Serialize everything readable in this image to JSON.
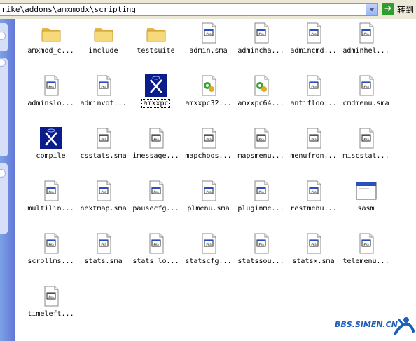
{
  "address": {
    "path": "rike\\addons\\amxmodx\\scripting",
    "go_label": "转到"
  },
  "colors": {
    "sidebar": "#6b8de0",
    "selection": "#316ac5",
    "folder": "#f3d36b"
  },
  "files": [
    {
      "name": "amxmod_c...",
      "icon": "folder-icon"
    },
    {
      "name": "include",
      "icon": "folder-icon"
    },
    {
      "name": "testsuite",
      "icon": "folder-icon"
    },
    {
      "name": "admin.sma",
      "icon": "sma-file-icon"
    },
    {
      "name": "adminchа...",
      "icon": "sma-file-icon"
    },
    {
      "name": "admincmd...",
      "icon": "sma-file-icon"
    },
    {
      "name": "adminhel...",
      "icon": "sma-file-icon"
    },
    {
      "name": "adminslo...",
      "icon": "sma-file-icon"
    },
    {
      "name": "adminvot...",
      "icon": "sma-file-icon"
    },
    {
      "name": "amxxpc",
      "icon": "amxxpc-exe-icon",
      "selected": true
    },
    {
      "name": "amxxpc32...",
      "icon": "dll-icon"
    },
    {
      "name": "amxxpc64...",
      "icon": "dll-icon"
    },
    {
      "name": "antifloo...",
      "icon": "sma-file-icon"
    },
    {
      "name": "cmdmenu.sma",
      "icon": "sma-file-icon"
    },
    {
      "name": "compile",
      "icon": "compile-exe-icon"
    },
    {
      "name": "csstats.sma",
      "icon": "sma-file-icon"
    },
    {
      "name": "imessage...",
      "icon": "sma-file-icon"
    },
    {
      "name": "mapchoos...",
      "icon": "sma-file-icon"
    },
    {
      "name": "mapsmenu...",
      "icon": "sma-file-icon"
    },
    {
      "name": "menufron...",
      "icon": "sma-file-icon"
    },
    {
      "name": "miscstat...",
      "icon": "sma-file-icon"
    },
    {
      "name": "multilin...",
      "icon": "sma-file-icon"
    },
    {
      "name": "nextmap.sma",
      "icon": "sma-file-icon"
    },
    {
      "name": "pausecfg...",
      "icon": "sma-file-icon"
    },
    {
      "name": "plmenu.sma",
      "icon": "sma-file-icon"
    },
    {
      "name": "pluginme...",
      "icon": "sma-file-icon"
    },
    {
      "name": "restmenu...",
      "icon": "sma-file-icon"
    },
    {
      "name": "sasm",
      "icon": "app-window-icon"
    },
    {
      "name": "scrollms...",
      "icon": "sma-file-icon"
    },
    {
      "name": "stats.sma",
      "icon": "sma-file-icon"
    },
    {
      "name": "stats_lo...",
      "icon": "sma-file-icon"
    },
    {
      "name": "statscfg...",
      "icon": "sma-file-icon"
    },
    {
      "name": "statssou...",
      "icon": "sma-file-icon"
    },
    {
      "name": "statsx.sma",
      "icon": "sma-file-icon"
    },
    {
      "name": "telemenu...",
      "icon": "sma-file-icon"
    },
    {
      "name": "timeleft...",
      "icon": "sma-file-icon"
    }
  ],
  "watermark": "BBS.SIMEN.CN"
}
